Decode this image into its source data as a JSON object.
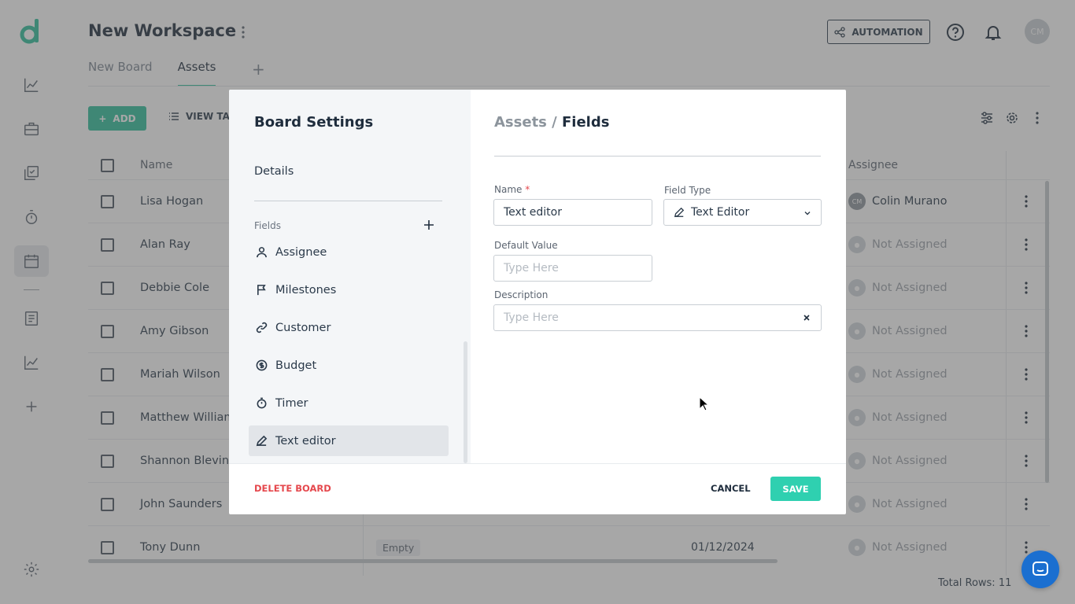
{
  "workspace": {
    "title": "New Workspace",
    "tabs": [
      {
        "label": "New Board",
        "active": false
      },
      {
        "label": "Assets",
        "active": true
      }
    ]
  },
  "header": {
    "automation_label": "AUTOMATION",
    "avatar_initials": "CM"
  },
  "toolbar": {
    "add_label": "ADD",
    "view_label": "VIEW TAB"
  },
  "table": {
    "columns": {
      "name": "Name",
      "assignee": "Assignee"
    },
    "rows": [
      {
        "name": "Lisa Hogan",
        "assignee": "Colin Murano",
        "initials": "CM",
        "assigned": true
      },
      {
        "name": "Alan Ray",
        "assignee": "Not Assigned",
        "assigned": false
      },
      {
        "name": "Debbie Cole",
        "assignee": "Not Assigned",
        "assigned": false
      },
      {
        "name": "Amy Gibson",
        "assignee": "Not Assigned",
        "assigned": false
      },
      {
        "name": "Mariah Wilson",
        "assignee": "Not Assigned",
        "assigned": false
      },
      {
        "name": "Matthew William",
        "assignee": "Not Assigned",
        "assigned": false
      },
      {
        "name": "Shannon Blevins",
        "assignee": "Not Assigned",
        "assigned": false
      },
      {
        "name": "John Saunders",
        "assignee": "Not Assigned",
        "assigned": false
      },
      {
        "name": "Tony Dunn",
        "assignee": "Not Assigned",
        "assigned": false,
        "chip": "Empty",
        "date": "01/12/2024"
      }
    ],
    "total_rows": "Total Rows: 11"
  },
  "modal": {
    "title": "Board Settings",
    "details_label": "Details",
    "fields_label": "Fields",
    "field_items": [
      {
        "label": "Assignee",
        "icon": "person-icon"
      },
      {
        "label": "Milestones",
        "icon": "flag-icon"
      },
      {
        "label": "Customer",
        "icon": "link-icon"
      },
      {
        "label": "Budget",
        "icon": "dollar-icon"
      },
      {
        "label": "Timer",
        "icon": "stopwatch-icon"
      },
      {
        "label": "Text editor",
        "icon": "pencil-icon",
        "selected": true
      }
    ],
    "breadcrumb": {
      "board": "Assets",
      "separator": " / ",
      "page": "Fields"
    },
    "form": {
      "name_label": "Name",
      "name_required": "*",
      "name_value": "Text editor",
      "field_type_label": "Field Type",
      "field_type_value": "Text Editor",
      "default_value_label": "Default Value",
      "default_value_placeholder": "Type Here",
      "description_label": "Description",
      "description_placeholder": "Type Here"
    },
    "footer": {
      "delete_label": "DELETE BOARD",
      "cancel_label": "CANCEL",
      "save_label": "SAVE"
    }
  },
  "colors": {
    "accent": "#2fbf9b",
    "save": "#2fd0b0",
    "danger": "#e5484d",
    "chat": "#1b6fd0"
  }
}
